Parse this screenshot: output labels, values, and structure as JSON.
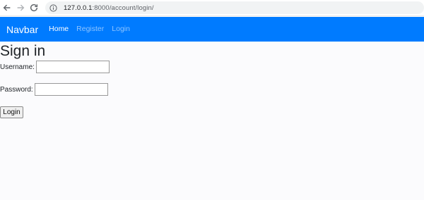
{
  "browser": {
    "url_host": "127.0.0.1",
    "url_rest": ":8000/account/login/",
    "icons": [
      "back-arrow-icon",
      "forward-arrow-icon",
      "reload-icon",
      "info-icon"
    ]
  },
  "navbar": {
    "brand": "Navbar",
    "links": [
      {
        "label": "Home",
        "active": true
      },
      {
        "label": "Register",
        "active": false
      },
      {
        "label": "Login",
        "active": false
      }
    ],
    "color": "#007bff"
  },
  "page": {
    "title": "Sign in",
    "username_label": "Username:",
    "username_value": "",
    "password_label": "Password:",
    "password_value": "",
    "submit_label": "Login"
  }
}
